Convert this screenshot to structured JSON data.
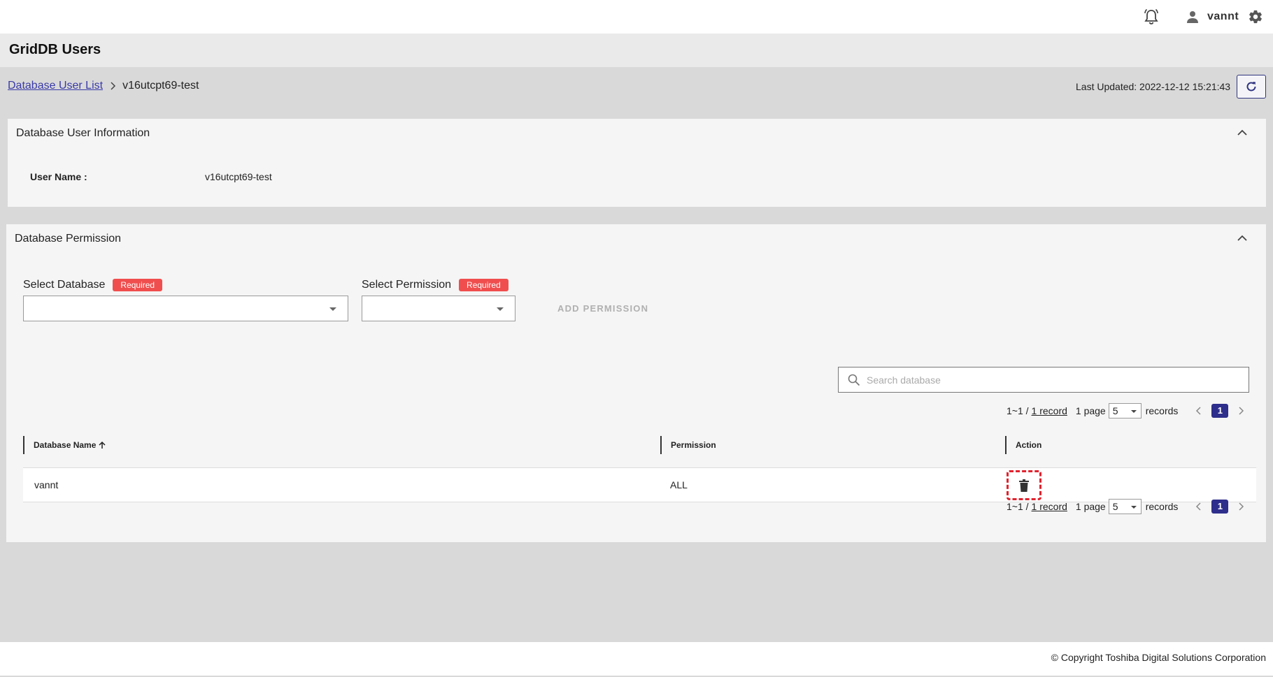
{
  "header": {
    "username": "vannt",
    "icons": {
      "notification": "bell-icon",
      "user": "user-icon",
      "settings": "gear-icon"
    }
  },
  "page": {
    "title": "GridDB Users"
  },
  "breadcrumb": {
    "parent": "Database User List",
    "current": "v16utcpt69-test"
  },
  "status": {
    "last_updated": "Last Updated: 2022-12-12 15:21:43"
  },
  "user_info": {
    "title": "Database User Information",
    "label": "User Name :",
    "value": "v16utcpt69-test"
  },
  "permission": {
    "title": "Database Permission",
    "select_database_label": "Select Database",
    "select_permission_label": "Select Permission",
    "required_badge": "Required",
    "add_button": "ADD PERMISSION",
    "search_placeholder": "Search database",
    "pager": {
      "range": "1~1 /",
      "total": "1 record",
      "pages": "1 page",
      "page_size": "5",
      "records_label": "records",
      "current_page": "1"
    },
    "columns": [
      "Database Name",
      "Permission",
      "Action"
    ],
    "rows": [
      {
        "database": "vannt",
        "permission": "ALL",
        "action_icon": "trash-icon"
      }
    ]
  },
  "footer": {
    "copyright": "© Copyright Toshiba Digital Solutions Corporation"
  },
  "colors": {
    "accent": "#2e2e8c",
    "required": "#f04e4e",
    "link": "#3a3aa8",
    "highlight": "#e0232e"
  }
}
